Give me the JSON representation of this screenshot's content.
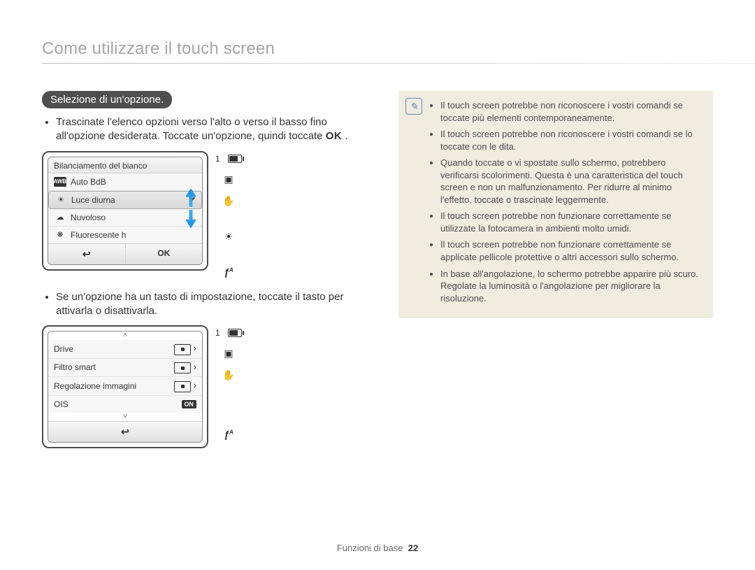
{
  "page": {
    "title": "Come utilizzare il touch screen",
    "footer_label": "Funzioni di base",
    "footer_page": "22"
  },
  "section": {
    "heading": "Selezione di un'opzione.",
    "para1_a": "Trascinate l'elenco opzioni verso l'alto o verso il basso fino all'opzione desiderata. Toccate un'opzione, quindi toccate ",
    "para1_b": ".",
    "ok_inline": "OK",
    "para2": "Se un'opzione ha un tasto di impostazione, toccate il tasto per attivarla o disattivarla."
  },
  "lcd1": {
    "title": "Bilanciamento del bianco",
    "items": [
      {
        "icon": "AWB",
        "label": "Auto BdB"
      },
      {
        "icon": "sun",
        "label": "Luce diurna",
        "selected": true
      },
      {
        "icon": "cloud",
        "label": "Nuvoloso"
      },
      {
        "icon": "fluor",
        "label": "Fluorescente h"
      }
    ],
    "back": "↩",
    "ok": "OK",
    "side": {
      "count": "1"
    }
  },
  "lcd2": {
    "items": [
      {
        "label": "Drive"
      },
      {
        "label": "Filtro smart"
      },
      {
        "label": "Regolazione immagini"
      },
      {
        "label": "OIS",
        "on": "ON"
      }
    ],
    "back": "↩",
    "side": {
      "count": "1"
    }
  },
  "notes": {
    "items": [
      "Il touch screen potrebbe non riconoscere i vostri comandi se toccate più elementi contemporaneamente.",
      "Il touch screen potrebbe non riconoscere i vostri comandi se lo toccate con le dita.",
      "Quando toccate o vi spostate sullo schermo, potrebbero verificarsi scolorimenti. Questa è una caratteristica del touch screen e non un malfunzionamento. Per ridurre al minimo l'effetto, toccate o trascinate leggermente.",
      "Il touch screen potrebbe non funzionare correttamente se utilizzate la fotocamera in ambienti molto umidi.",
      "Il touch screen potrebbe non funzionare correttamente se applicate pellicole protettive o altri accessori sullo schermo.",
      "In base all'angolazione, lo schermo potrebbe apparire più scuro. Regolate la luminosità o l'angolazione per migliorare la risoluzione."
    ]
  }
}
